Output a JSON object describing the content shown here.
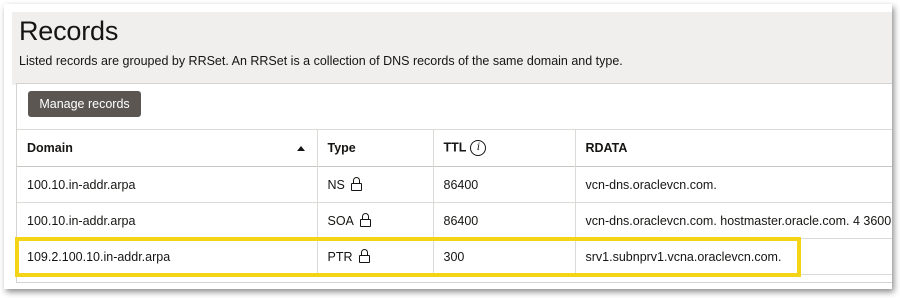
{
  "header": {
    "title": "Records",
    "subtitle": "Listed records are grouped by RRSet. An RRSet is a collection of DNS records of the same domain and type."
  },
  "toolbar": {
    "manage_label": "Manage records"
  },
  "table": {
    "columns": {
      "domain": "Domain",
      "type": "Type",
      "ttl": "TTL",
      "rdata": "RDATA"
    },
    "sort": {
      "column": "Domain",
      "direction": "ascending"
    },
    "rows": [
      {
        "domain": "100.10.in-addr.arpa",
        "type": "NS",
        "ttl": "86400",
        "rdata": "vcn-dns.oraclevcn.com.",
        "locked": true
      },
      {
        "domain": "100.10.in-addr.arpa",
        "type": "SOA",
        "ttl": "86400",
        "rdata": "vcn-dns.oraclevcn.com. hostmaster.oracle.com. 4 3600",
        "locked": true
      },
      {
        "domain": "109.2.100.10.in-addr.arpa",
        "type": "PTR",
        "ttl": "300",
        "rdata": "srv1.subnprv1.vcna.oraclevcn.com.",
        "locked": true,
        "highlighted": true
      }
    ]
  },
  "colors": {
    "button_bg": "#5b5652",
    "header_bg": "#f1efed",
    "highlight": "#f3d417"
  },
  "icons": {
    "sort": "sort-ascending-icon",
    "info": "info-icon",
    "lock": "lock-icon"
  }
}
